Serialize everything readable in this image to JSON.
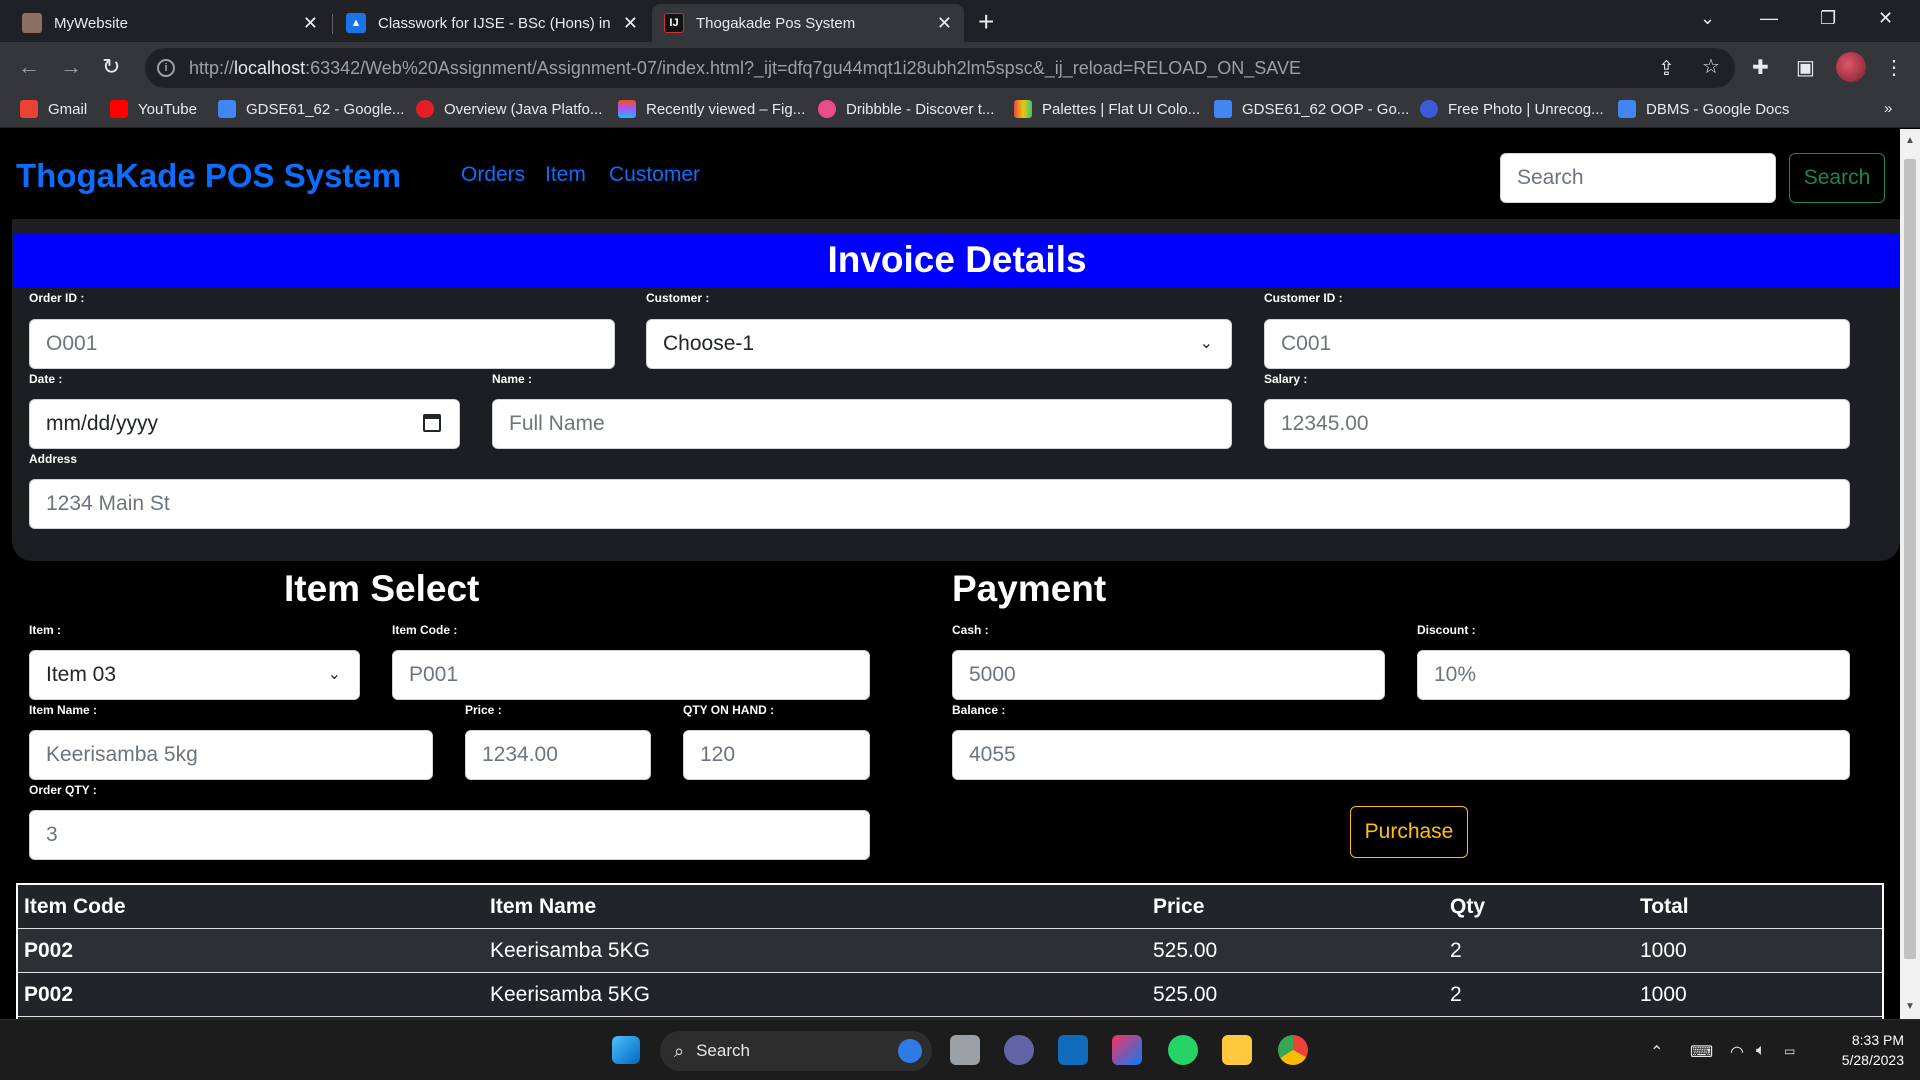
{
  "browser": {
    "tabs": [
      {
        "title": "MyWebsite",
        "active": false
      },
      {
        "title": "Classwork for IJSE - BSc (Hons) in Cc",
        "active": false
      },
      {
        "title": "Thogakade Pos System",
        "active": true
      }
    ],
    "url_prefix": "http://",
    "url_host": "localhost",
    "url_rest": ":63342/Web%20Assignment/Assignment-07/index.html?_ijt=dfq7gu44mqt1i28ubh2lm5spsc&_ij_reload=RELOAD_ON_SAVE",
    "bookmarks": [
      "Gmail",
      "YouTube",
      "GDSE61_62 - Google...",
      "Overview (Java Platfo...",
      "Recently viewed – Fig...",
      "Dribbble - Discover t...",
      "Palettes | Flat UI Colo...",
      "GDSE61_62 OOP - Go...",
      "Free Photo | Unrecog...",
      "DBMS - Google Docs"
    ]
  },
  "navbar": {
    "brand": "ThogaKade POS System",
    "links": [
      "Orders",
      "Item",
      "Customer"
    ],
    "search_placeholder": "Search",
    "search_button": "Search"
  },
  "invoice": {
    "title": "Invoice Details",
    "order_id": {
      "label": "Order ID :",
      "placeholder": "O001"
    },
    "customer": {
      "label": "Customer :",
      "selected": "Choose-1"
    },
    "customer_id": {
      "label": "Customer ID :",
      "placeholder": "C001"
    },
    "date": {
      "label": "Date :",
      "placeholder": "mm/dd/yyyy"
    },
    "name": {
      "label": "Name :",
      "placeholder": "Full Name"
    },
    "salary": {
      "label": "Salary :",
      "placeholder": "12345.00"
    },
    "address": {
      "label": "Address",
      "placeholder": "1234 Main St"
    }
  },
  "item_select": {
    "title": "Item Select",
    "item": {
      "label": "Item :",
      "selected": "Item 03"
    },
    "item_code": {
      "label": "Item Code :",
      "placeholder": "P001"
    },
    "item_name": {
      "label": "Item Name :",
      "placeholder": "Keerisamba 5kg"
    },
    "price": {
      "label": "Price :",
      "placeholder": "1234.00"
    },
    "qty_on_hand": {
      "label": "QTY ON HAND :",
      "placeholder": "120"
    },
    "order_qty": {
      "label": "Order QTY :",
      "placeholder": "3"
    }
  },
  "payment": {
    "title": "Payment",
    "cash": {
      "label": "Cash :",
      "placeholder": "5000"
    },
    "discount": {
      "label": "Discount :",
      "placeholder": "10%"
    },
    "balance": {
      "label": "Balance :",
      "placeholder": "4055"
    },
    "purchase_button": "Purchase"
  },
  "table": {
    "headers": [
      "Item Code",
      "Item Name",
      "Price",
      "Qty",
      "Total"
    ],
    "rows": [
      [
        "P002",
        "Keerisamba 5KG",
        "525.00",
        "2",
        "1000"
      ],
      [
        "P002",
        "Keerisamba 5KG",
        "525.00",
        "2",
        "1000"
      ]
    ]
  },
  "taskbar": {
    "search": "Search",
    "time": "8:33 PM",
    "date": "5/28/2023"
  },
  "colors": {
    "brand": "#0d6efd",
    "invoice_bar": "#0000ff",
    "purchase": "#ffc107",
    "nav_search": "#198754"
  }
}
